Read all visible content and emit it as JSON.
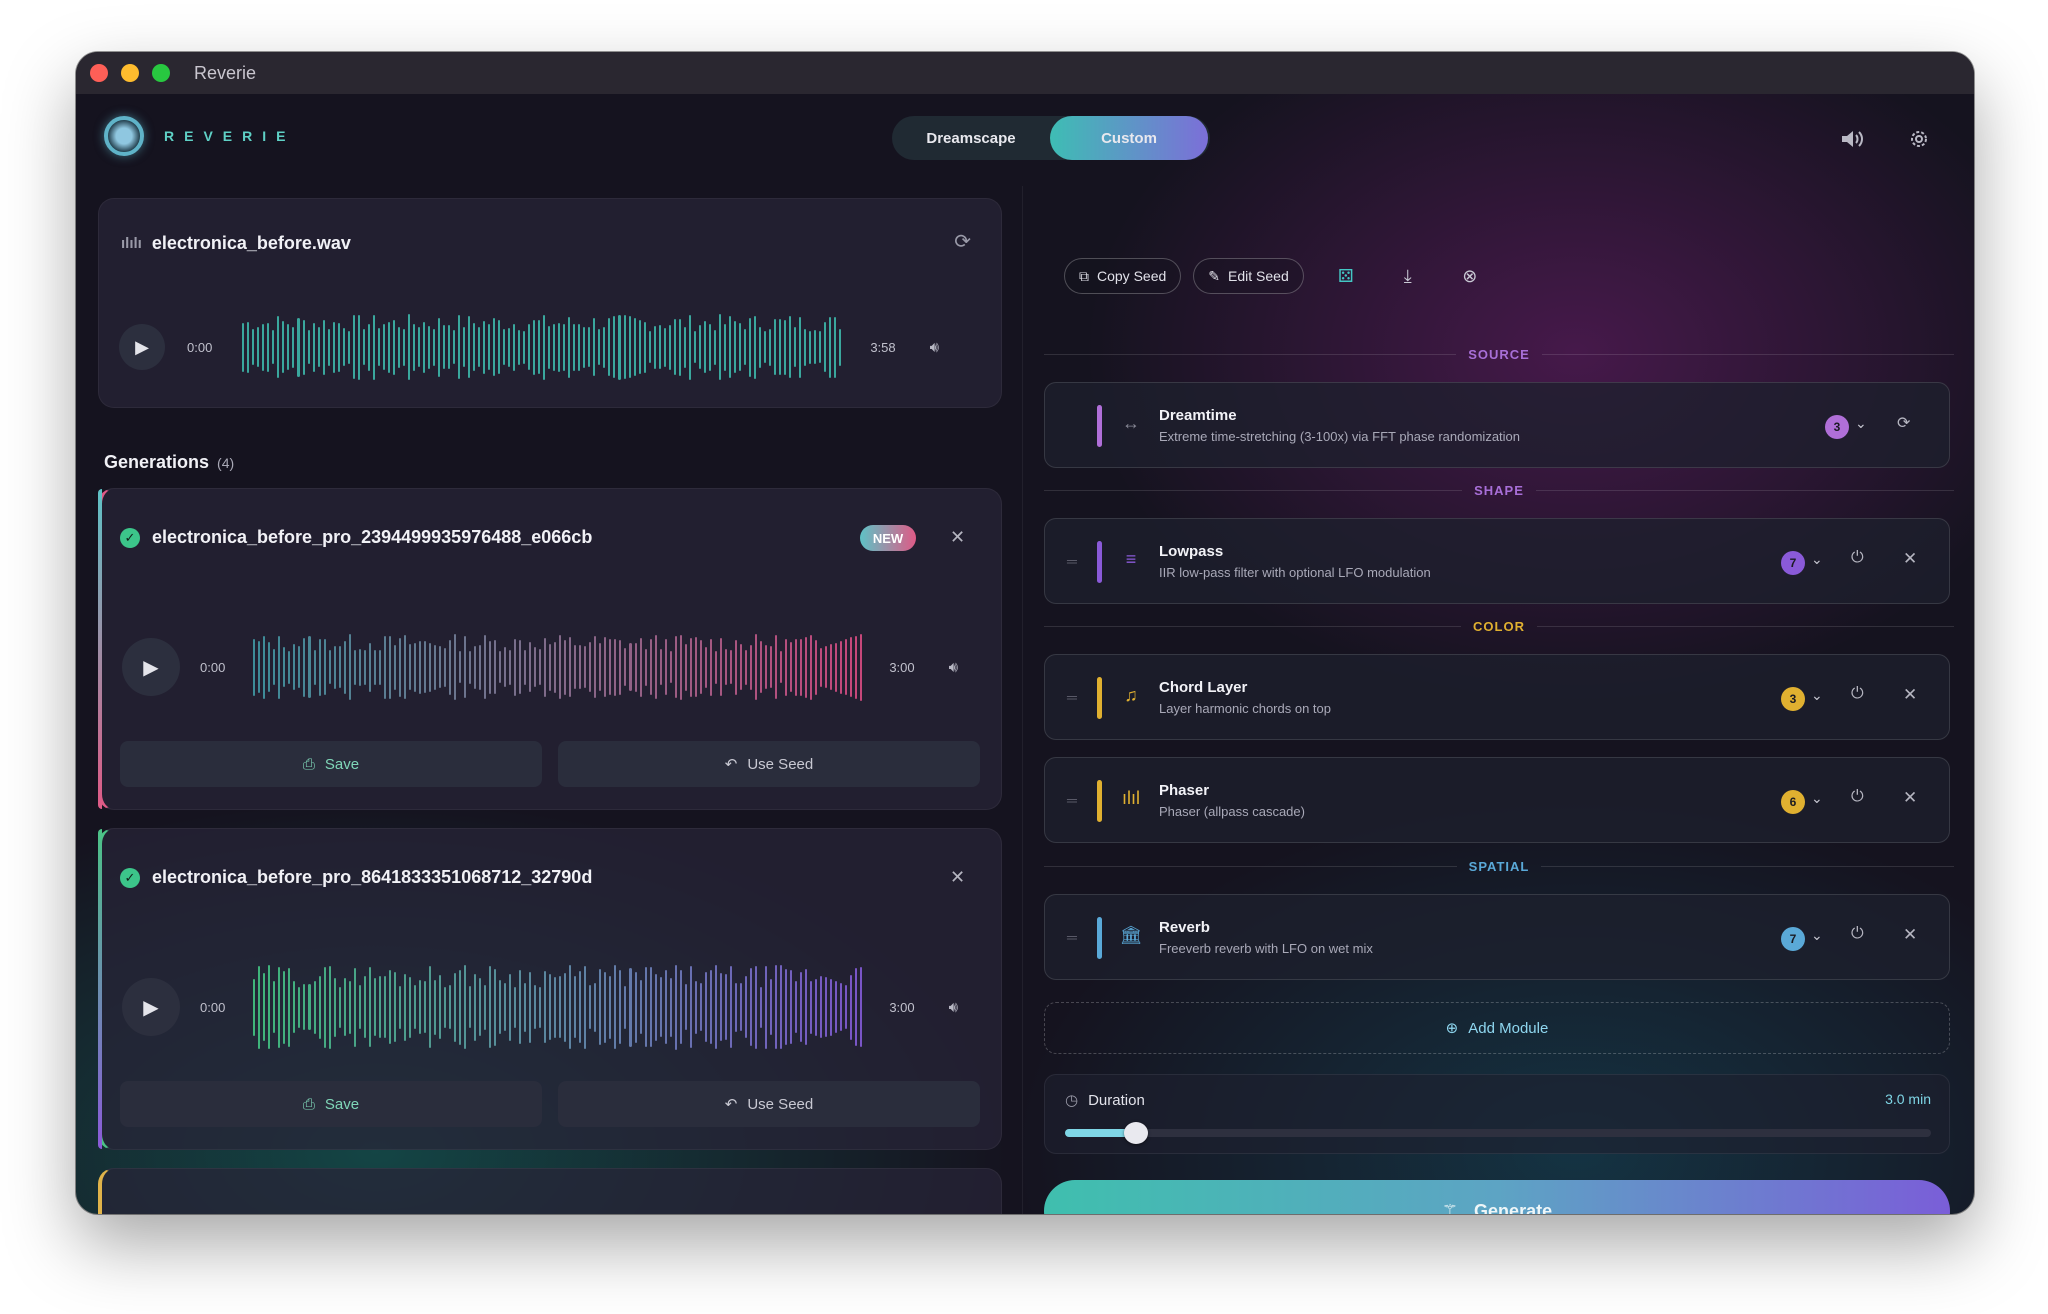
{
  "window": {
    "title": "Reverie"
  },
  "header": {
    "logo_text": "REVERIE",
    "tabs": [
      {
        "label": "Dreamscape",
        "active": false
      },
      {
        "label": "Custom",
        "active": true
      }
    ],
    "icons": [
      "speaker-icon",
      "gear-icon"
    ]
  },
  "source": {
    "filename": "electronica_before.wav",
    "current_time": "0:00",
    "duration": "3:58",
    "waveform_color": "#3aa79d"
  },
  "generations": {
    "title": "Generations",
    "count": "(4)",
    "items": [
      {
        "name": "electronica_before_pro_2394499935976488_e066cb",
        "badge": "NEW",
        "current_time": "0:00",
        "duration": "3:00",
        "save_label": "Save",
        "seed_label": "Use Seed",
        "accent": "#df5a86"
      },
      {
        "name": "electronica_before_pro_8641833351068712_32790d",
        "badge": "",
        "current_time": "0:00",
        "duration": "3:00",
        "save_label": "Save",
        "seed_label": "Use Seed",
        "accent": "#4cc387"
      }
    ]
  },
  "toolbar": {
    "copy_seed": "Copy Seed",
    "edit_seed": "Edit Seed"
  },
  "sections": {
    "source": "SOURCE",
    "shape": "SHAPE",
    "color": "COLOR",
    "spatial": "SPATIAL"
  },
  "modules": [
    {
      "name": "Dreamtime",
      "desc": "Extreme time-stretching (3-100x) via FFT phase randomization",
      "level": "3",
      "color": "#b06fd8"
    },
    {
      "name": "Lowpass",
      "desc": "IIR low-pass filter with optional LFO modulation",
      "level": "7",
      "color": "#8a5ad8"
    },
    {
      "name": "Chord Layer",
      "desc": "Layer harmonic chords on top",
      "level": "3",
      "color": "#e0b030"
    },
    {
      "name": "Phaser",
      "desc": "Phaser (allpass cascade)",
      "level": "6",
      "color": "#e0b030"
    },
    {
      "name": "Reverb",
      "desc": "Freeverb reverb with LFO on wet mix",
      "level": "7",
      "color": "#5aa9d8"
    }
  ],
  "add_module": "Add Module",
  "duration": {
    "label": "Duration",
    "value": "3.0 min",
    "fraction": 0.082
  },
  "generate_label": "Generate"
}
